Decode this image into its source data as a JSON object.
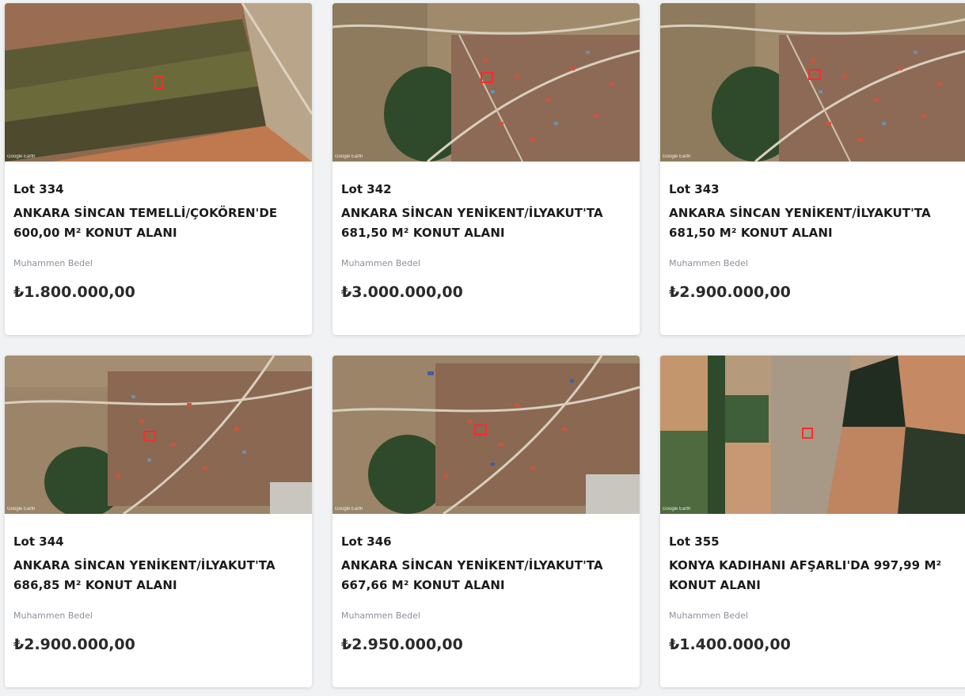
{
  "watermark": "Google Earth",
  "price_label": "Muhammen Bedel",
  "lots": [
    {
      "lot": "Lot 334",
      "title": "ANKARA SİNCAN TEMELLİ/ÇOKÖREN'DE 600,00 M² KONUT ALANI",
      "price": "₺1.800.000,00",
      "image": "satellite-farmland-image"
    },
    {
      "lot": "Lot 342",
      "title": "ANKARA SİNCAN YENİKENT/İLYAKUT'TA 681,50 M² KONUT ALANI",
      "price": "₺3.000.000,00",
      "image": "satellite-village-image"
    },
    {
      "lot": "Lot 343",
      "title": "ANKARA SİNCAN YENİKENT/İLYAKUT'TA 681,50 M² KONUT ALANI",
      "price": "₺2.900.000,00",
      "image": "satellite-village-image"
    },
    {
      "lot": "Lot 344",
      "title": "ANKARA SİNCAN YENİKENT/İLYAKUT'TA 686,85 M² KONUT ALANI",
      "price": "₺2.900.000,00",
      "image": "satellite-village-image"
    },
    {
      "lot": "Lot 346",
      "title": "ANKARA SİNCAN YENİKENT/İLYAKUT'TA 667,66 M² KONUT ALANI",
      "price": "₺2.950.000,00",
      "image": "satellite-village-image"
    },
    {
      "lot": "Lot 355",
      "title": "KONYA KADIHANI AFŞARLI'DA 997,99 M² KONUT ALANI",
      "price": "₺1.400.000,00",
      "image": "satellite-fields-image"
    }
  ]
}
